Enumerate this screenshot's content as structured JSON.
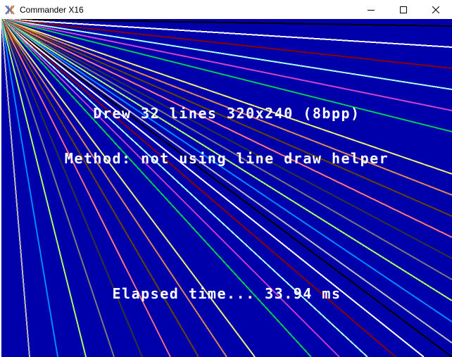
{
  "window": {
    "title": "Commander X16",
    "icon": "x16-logo-icon",
    "controls": [
      "minimize-icon",
      "maximize-icon",
      "close-icon"
    ]
  },
  "screen": {
    "background": "#0000aa",
    "text_color": "#ffffff",
    "line_colors": [
      "#000000",
      "#ffffff",
      "#880000",
      "#aaffee",
      "#cc44cc",
      "#00cc55",
      "#0000aa",
      "#eeee77",
      "#dd8855",
      "#664400",
      "#ff7777",
      "#333333",
      "#777777",
      "#aaff66",
      "#0088ff",
      "#bbbbbb"
    ],
    "lines": {
      "count": 32,
      "resolution": "320x240",
      "bpp": 8
    },
    "messages": {
      "line1": "Drew 32 lines 320x240 (8bpp)",
      "line2": "Method: not using line draw helper",
      "line3": "Elapsed time... 33.94 ms"
    }
  }
}
